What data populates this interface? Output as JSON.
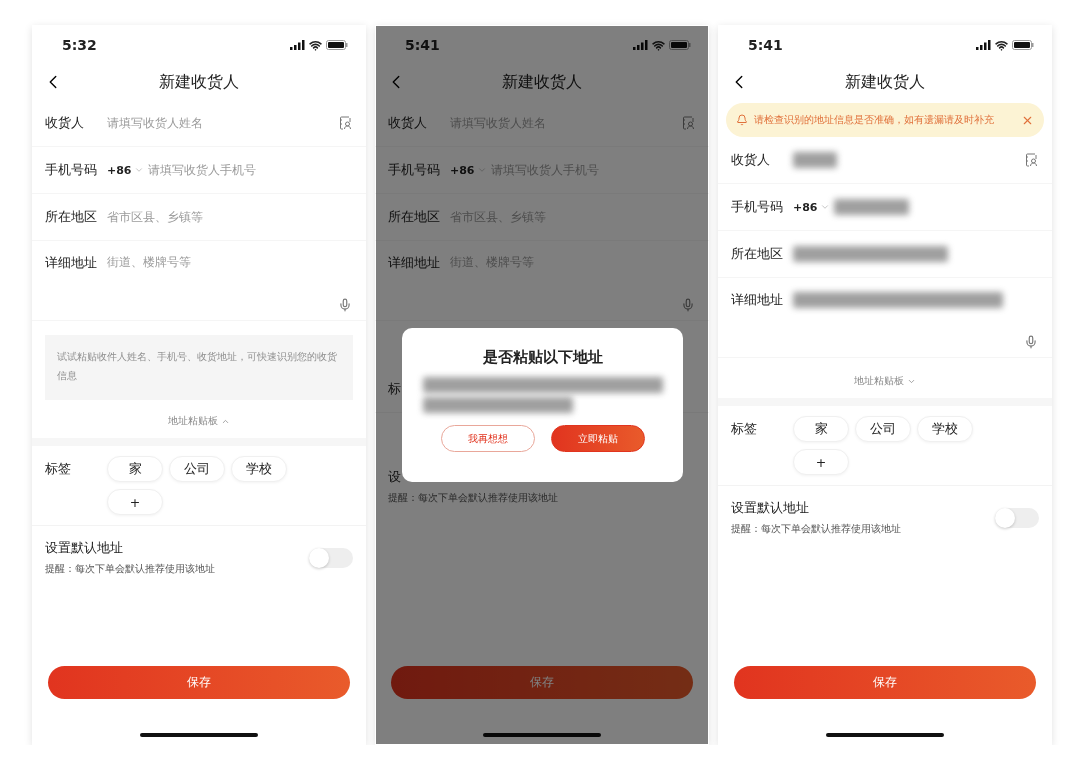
{
  "screens": [
    {
      "time": "5:32",
      "title": "新建收货人",
      "dimmed": false,
      "fields": [
        {
          "kind": "name",
          "label": "收货人",
          "placeholder": "请填写收货人姓名",
          "redacted": false
        },
        {
          "kind": "phone",
          "label": "手机号码",
          "prefix": "+86",
          "placeholder": "请填写收货人手机号",
          "redacted": false
        },
        {
          "kind": "region",
          "label": "所在地区",
          "placeholder": "省市区县、乡镇等",
          "redacted": false
        },
        {
          "kind": "detail",
          "label": "详细地址",
          "placeholder": "街道、楼牌号等",
          "redacted": false
        }
      ],
      "paste_board": {
        "label": "地址粘贴板",
        "expanded": true,
        "hint": "试试粘贴收件人姓名、手机号、收货地址，可快速识别您的收货信息"
      },
      "tags": {
        "label": "标签",
        "items": [
          "家",
          "公司",
          "学校"
        ],
        "add": "+"
      },
      "default_address": {
        "title": "设置默认地址",
        "hint": "提醒：每次下单会默认推荐使用该地址",
        "on": false
      },
      "save": "保存"
    },
    {
      "time": "5:41",
      "title": "新建收货人",
      "dimmed": true,
      "fields": [
        {
          "kind": "name",
          "label": "收货人",
          "placeholder": "请填写收货人姓名",
          "redacted": false
        },
        {
          "kind": "phone",
          "label": "手机号码",
          "prefix": "+86",
          "placeholder": "请填写收货人手机号",
          "redacted": false
        },
        {
          "kind": "region",
          "label": "所在地区",
          "placeholder": "省市区县、乡镇等",
          "redacted": false
        },
        {
          "kind": "detail",
          "label": "详细地址",
          "placeholder": "街道、楼牌号等",
          "redacted": false
        }
      ],
      "tags": {
        "label": "标"
      },
      "default_address": {
        "title": "设",
        "hint": "提醒：每次下单会默认推荐使用该地址"
      },
      "dialog": {
        "title": "是否粘贴以下地址",
        "redacted": true,
        "buttons": [
          {
            "label": "我再想想",
            "kind": "secondary"
          },
          {
            "label": "立即粘贴",
            "kind": "primary"
          }
        ]
      },
      "save": "保存"
    },
    {
      "time": "5:41",
      "title": "新建收货人",
      "dimmed": false,
      "notice": {
        "text": "请检查识别的地址信息是否准确，如有遗漏请及时补充"
      },
      "fields": [
        {
          "kind": "name",
          "label": "收货人",
          "redacted": true
        },
        {
          "kind": "phone",
          "label": "手机号码",
          "prefix": "+86",
          "redacted": true
        },
        {
          "kind": "region",
          "label": "所在地区",
          "redacted": true
        },
        {
          "kind": "detail",
          "label": "详细地址",
          "redacted": true
        }
      ],
      "paste_board": {
        "label": "地址粘贴板",
        "expanded": false
      },
      "tags": {
        "label": "标签",
        "items": [
          "家",
          "公司",
          "学校"
        ],
        "add": "+"
      },
      "default_address": {
        "title": "设置默认地址",
        "hint": "提醒：每次下单会默认推荐使用该地址",
        "on": false
      },
      "save": "保存"
    }
  ]
}
